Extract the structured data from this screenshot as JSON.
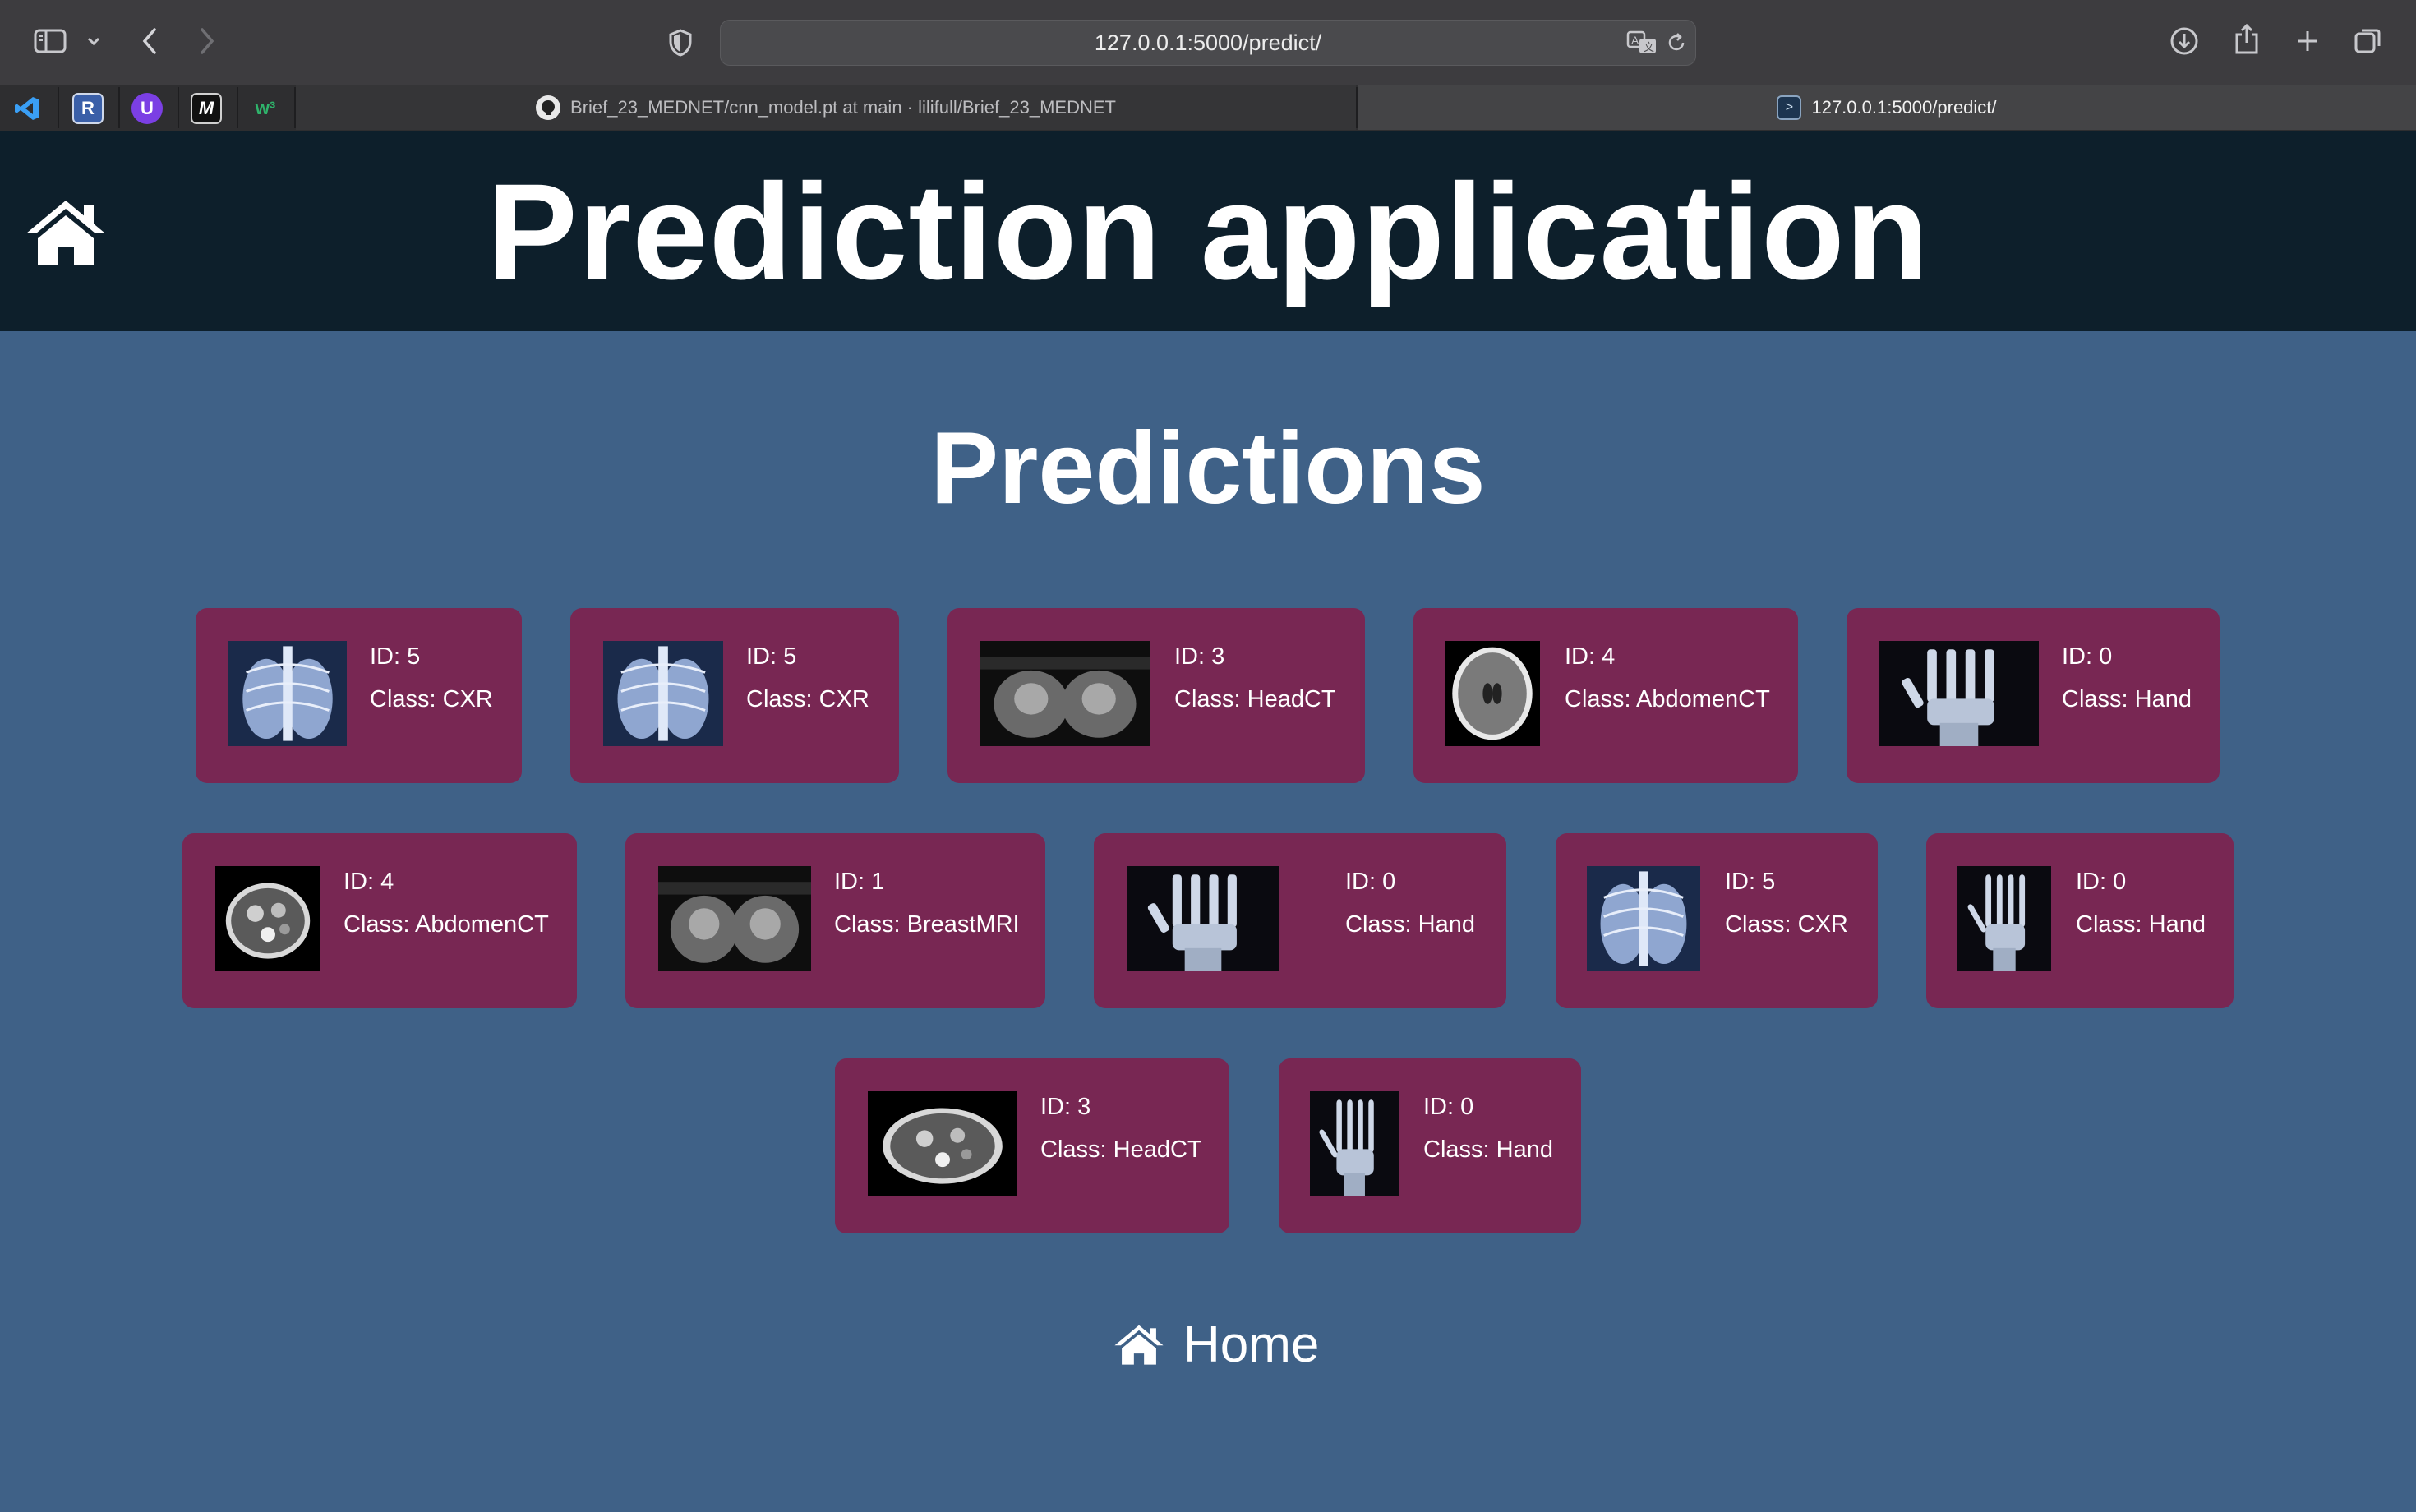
{
  "browser": {
    "url": "127.0.0.1:5000/predict/",
    "tabs": [
      {
        "label": "Brief_23_MEDNET/cnn_model.pt at main · lilifull/Brief_23_MEDNET",
        "icon": "github-icon"
      },
      {
        "label": "127.0.0.1:5000/predict/",
        "icon": "terminal-icon"
      }
    ],
    "pinned": [
      {
        "name": "vscode",
        "glyph": "✕"
      },
      {
        "name": "r",
        "glyph": "R"
      },
      {
        "name": "proton",
        "glyph": "U"
      },
      {
        "name": "medium",
        "glyph": "M"
      },
      {
        "name": "w3schools",
        "glyph": "w³"
      }
    ]
  },
  "header": {
    "title": "Prediction application"
  },
  "main": {
    "heading": "Predictions",
    "predictions": [
      {
        "id": "ID: 5",
        "cls": "Class: CXR",
        "image": "chest-xray"
      },
      {
        "id": "ID: 5",
        "cls": "Class: CXR",
        "image": "chest-xray"
      },
      {
        "id": "ID: 3",
        "cls": "Class: HeadCT",
        "image": "breast-mri"
      },
      {
        "id": "ID: 4",
        "cls": "Class: AbdomenCT",
        "image": "head-ct"
      },
      {
        "id": "ID: 0",
        "cls": "Class: Hand",
        "image": "hand-xray"
      },
      {
        "id": "ID: 4",
        "cls": "Class: AbdomenCT",
        "image": "abdomen-ct"
      },
      {
        "id": "ID: 1",
        "cls": "Class: BreastMRI",
        "image": "breast-mri"
      },
      {
        "id": "ID: 0",
        "cls": "Class: Hand",
        "image": "hand-xray"
      },
      {
        "id": "ID: 5",
        "cls": "Class: CXR",
        "image": "chest-xray"
      },
      {
        "id": "ID: 0",
        "cls": "Class: Hand",
        "image": "hand-xray"
      },
      {
        "id": "ID: 3",
        "cls": "Class: HeadCT",
        "image": "abdomen-ct"
      },
      {
        "id": "ID: 0",
        "cls": "Class: Hand",
        "image": "hand-xray"
      }
    ]
  },
  "footer": {
    "home_label": "Home"
  },
  "colors": {
    "header_bg": "#0d1f2b",
    "page_bg": "#3f6187",
    "card_bg": "#782753"
  }
}
